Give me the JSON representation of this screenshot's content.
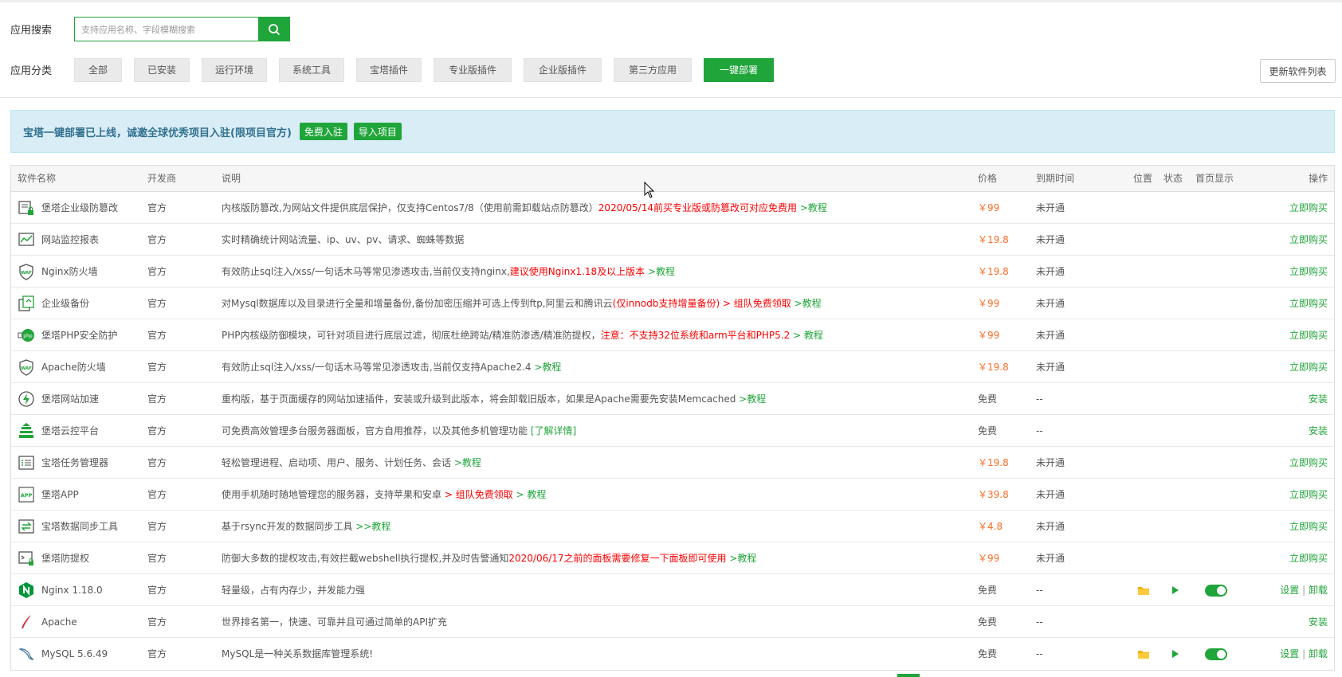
{
  "search": {
    "label": "应用搜索",
    "placeholder": "支持应用名称、字段模糊搜索"
  },
  "category": {
    "label": "应用分类",
    "items": [
      "全部",
      "已安装",
      "运行环境",
      "系统工具",
      "宝塔插件",
      "专业版插件",
      "企业版插件",
      "第三方应用",
      "一键部署"
    ],
    "active": "一键部署"
  },
  "update_button": "更新软件列表",
  "notice": {
    "text": "宝塔一键部署已上线，诚邀全球优秀项目入驻(限项目官方)",
    "btn_free": "免费入驻",
    "btn_import": "导入项目"
  },
  "table": {
    "headers": {
      "name": "软件名称",
      "developer": "开发商",
      "description": "说明",
      "price": "价格",
      "expire": "到期时间",
      "position": "位置",
      "status": "状态",
      "homepage": "首页显示",
      "operation": "操作"
    },
    "rows": [
      {
        "name": "堡塔企业级防篡改",
        "icon": "lock-file-icon",
        "developer": "官方",
        "desc": "内核版防篡改,为网站文件提供底层保护，仅支持Centos7/8（使用前需卸载站点防篡改）",
        "desc_red": "2020/05/14前买专业版或防篡改可对应免费用",
        "desc_green": " >教程",
        "price": "￥99",
        "price_type": "pay",
        "expire": "未开通",
        "op": "立即购买",
        "installed": false
      },
      {
        "name": "网站监控报表",
        "icon": "chart-icon",
        "developer": "官方",
        "desc": "实时精确统计网站流量、ip、uv、pv、请求、蜘蛛等数据",
        "desc_red": "",
        "desc_green": "",
        "price": "￥19.8",
        "price_type": "pay",
        "expire": "未开通",
        "op": "立即购买",
        "installed": false
      },
      {
        "name": "Nginx防火墙",
        "icon": "waf-shield-icon",
        "developer": "官方",
        "desc": "有效防止sql注入/xss/一句话木马等常见渗透攻击,当前仅支持nginx,",
        "desc_red": "建议使用Nginx1.18及以上版本",
        "desc_green": " >教程",
        "price": "￥19.8",
        "price_type": "pay",
        "expire": "未开通",
        "op": "立即购买",
        "installed": false
      },
      {
        "name": "企业级备份",
        "icon": "backup-icon",
        "developer": "官方",
        "desc": "对Mysql数据库以及目录进行全量和增量备份,备份加密压缩并可选上传到ftp,阿里云和腾讯云",
        "desc_red": "(仅innodb支持增量备份) > 组队免费领取",
        "desc_green": " >教程",
        "price": "￥99",
        "price_type": "pay",
        "expire": "未开通",
        "op": "立即购买",
        "installed": false
      },
      {
        "name": "堡塔PHP安全防护",
        "icon": "php-guard-icon",
        "developer": "官方",
        "desc": "PHP内核级防御模块，可针对项目进行底层过滤，彻底杜绝跨站/精准防渗透/精准防提权，",
        "desc_red": "注意：不支持32位系统和arm平台和PHP5.2",
        "desc_green": " > 教程",
        "price": "￥99",
        "price_type": "pay",
        "expire": "未开通",
        "op": "立即购买",
        "installed": false
      },
      {
        "name": "Apache防火墙",
        "icon": "waf-shield-icon",
        "developer": "官方",
        "desc": "有效防止sql注入/xss/一句话木马等常见渗透攻击,当前仅支持Apache2.4",
        "desc_red": "",
        "desc_green": " >教程",
        "price": "￥19.8",
        "price_type": "pay",
        "expire": "未开通",
        "op": "立即购买",
        "installed": false
      },
      {
        "name": "堡塔网站加速",
        "icon": "lightning-icon",
        "developer": "官方",
        "desc": "重构版，基于页面缓存的网站加速插件，安装或升级到此版本，将会卸载旧版本，如果是Apache需要先安装Memcached",
        "desc_red": "",
        "desc_green": " >教程",
        "price": "免费",
        "price_type": "free",
        "expire": "--",
        "op": "安装",
        "installed": false
      },
      {
        "name": "堡塔云控平台",
        "icon": "cloud-tower-icon",
        "developer": "官方",
        "desc": "可免费高效管理多台服务器面板，官方自用推荐，以及其他多机管理功能 ",
        "desc_red": "",
        "desc_green": "[了解详情]",
        "price": "免费",
        "price_type": "free",
        "expire": "--",
        "op": "安装",
        "installed": false
      },
      {
        "name": "宝塔任务管理器",
        "icon": "task-list-icon",
        "developer": "官方",
        "desc": "轻松管理进程、启动项、用户、服务、计划任务、会话",
        "desc_red": "",
        "desc_green": " >教程",
        "price": "￥19.8",
        "price_type": "pay",
        "expire": "未开通",
        "op": "立即购买",
        "installed": false
      },
      {
        "name": "堡塔APP",
        "icon": "app-icon",
        "developer": "官方",
        "desc": "使用手机随时随地管理您的服务器，支持苹果和安卓 ",
        "desc_red": "> 组队免费领取",
        "desc_green": " > 教程",
        "price": "￥39.8",
        "price_type": "pay",
        "expire": "未开通",
        "op": "立即购买",
        "installed": false
      },
      {
        "name": "宝塔数据同步工具",
        "icon": "sync-icon",
        "developer": "官方",
        "desc": "基于rsync开发的数据同步工具 ",
        "desc_red": "",
        "desc_green": ">>教程",
        "price": "￥4.8",
        "price_type": "pay",
        "expire": "未开通",
        "op": "立即购买",
        "installed": false
      },
      {
        "name": "堡塔防提权",
        "icon": "terminal-lock-icon",
        "developer": "官方",
        "desc": "防御大多数的提权攻击,有效拦截webshell执行提权,并及时告警通知",
        "desc_red": "2020/06/17之前的面板需要修复一下面板即可使用",
        "desc_green": " >教程",
        "price": "￥99",
        "price_type": "pay",
        "expire": "未开通",
        "op": "立即购买",
        "installed": false
      },
      {
        "name": "Nginx 1.18.0",
        "icon": "nginx-icon",
        "developer": "官方",
        "desc": "轻量级，占有内存少，并发能力强",
        "desc_red": "",
        "desc_green": "",
        "price": "免费",
        "price_type": "free",
        "expire": "--",
        "op": "",
        "op_set": "设置",
        "op_uninstall": "卸载",
        "installed": true
      },
      {
        "name": "Apache",
        "icon": "apache-feather-icon",
        "developer": "官方",
        "desc": "世界排名第一，快速、可靠并且可通过简单的API扩充",
        "desc_red": "",
        "desc_green": "",
        "price": "免费",
        "price_type": "free",
        "expire": "--",
        "op": "安装",
        "installed": false
      },
      {
        "name": "MySQL 5.6.49",
        "icon": "mysql-dolphin-icon",
        "developer": "官方",
        "desc": "MySQL是一种关系数据库管理系统!",
        "desc_red": "",
        "desc_green": "",
        "price": "免费",
        "price_type": "free",
        "expire": "--",
        "op": "",
        "op_set": "设置",
        "op_uninstall": "卸载",
        "installed": true
      }
    ]
  },
  "colors": {
    "brand_green": "#20a53a",
    "price_orange": "#fc6d26",
    "alert_red": "#ff0000",
    "notice_bg": "#d9edf7"
  }
}
